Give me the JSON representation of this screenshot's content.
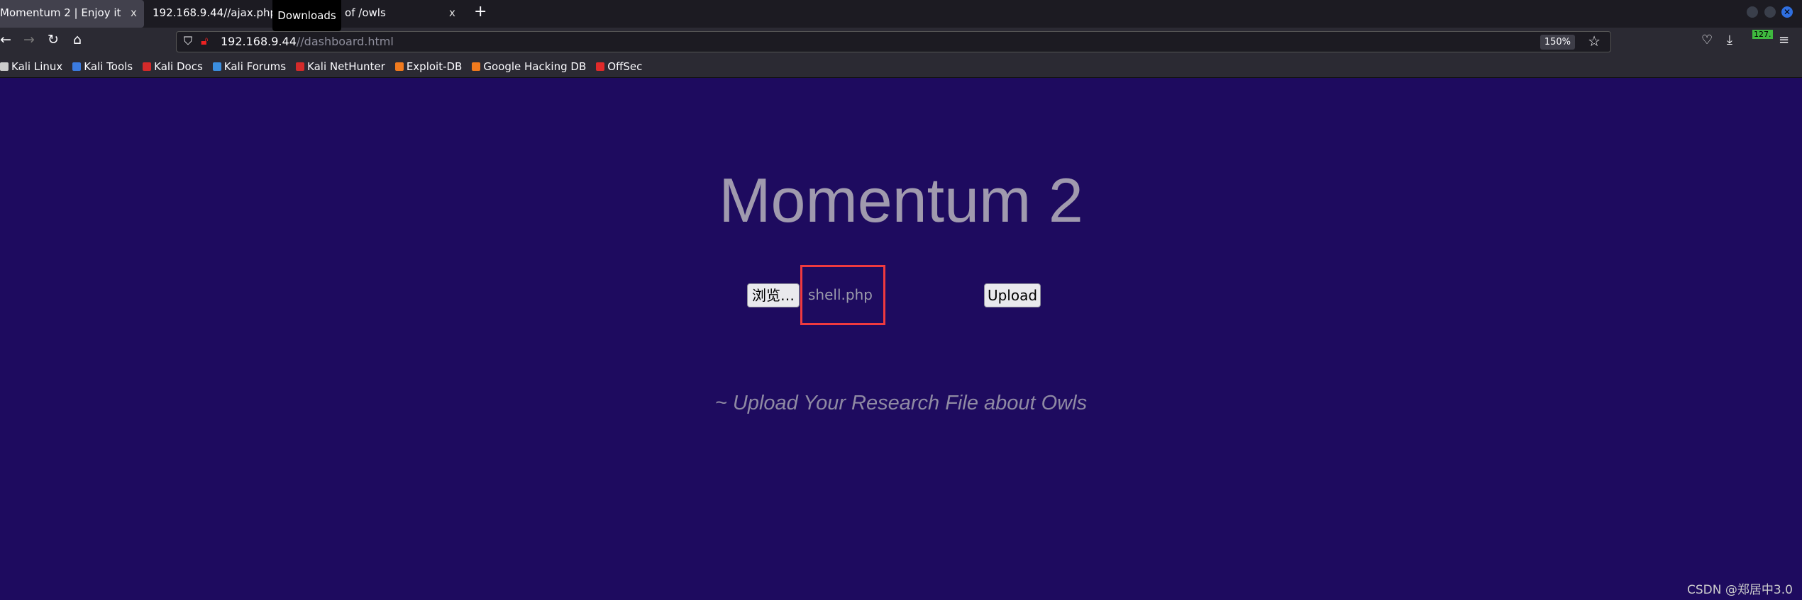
{
  "browser": {
    "tabs": [
      {
        "title": "Momentum 2 | Enjoy it",
        "active": true
      },
      {
        "title": "192.168.9.44//ajax.php"
      },
      {
        "title": "Index of /owls"
      }
    ],
    "tooltip": "Downloads",
    "new_tab": "+",
    "close": "x",
    "url": {
      "host": "192.168.9.44",
      "path": "//dashboard.html"
    },
    "zoom": "150%",
    "badge": "127.",
    "bookmarks": [
      {
        "label": "Kali Linux",
        "color": "#cccccc"
      },
      {
        "label": "Kali Tools",
        "color": "#3b7be0"
      },
      {
        "label": "Kali Docs",
        "color": "#d42a2a"
      },
      {
        "label": "Kali Forums",
        "color": "#3b8ee0"
      },
      {
        "label": "Kali NetHunter",
        "color": "#d42a2a"
      },
      {
        "label": "Exploit-DB",
        "color": "#f07a1e"
      },
      {
        "label": "Google Hacking DB",
        "color": "#f07a1e"
      },
      {
        "label": "OffSec",
        "color": "#e02a2a"
      }
    ]
  },
  "page": {
    "title": "Momentum 2",
    "browse_label": "浏览…",
    "file_name": "shell.php",
    "upload_label": "Upload",
    "subtitle": "~ Upload Your Research File about Owls",
    "highlight_color": "#f03a3f",
    "background": "#1e0b5f"
  },
  "watermark": "CSDN @郑居中3.0"
}
